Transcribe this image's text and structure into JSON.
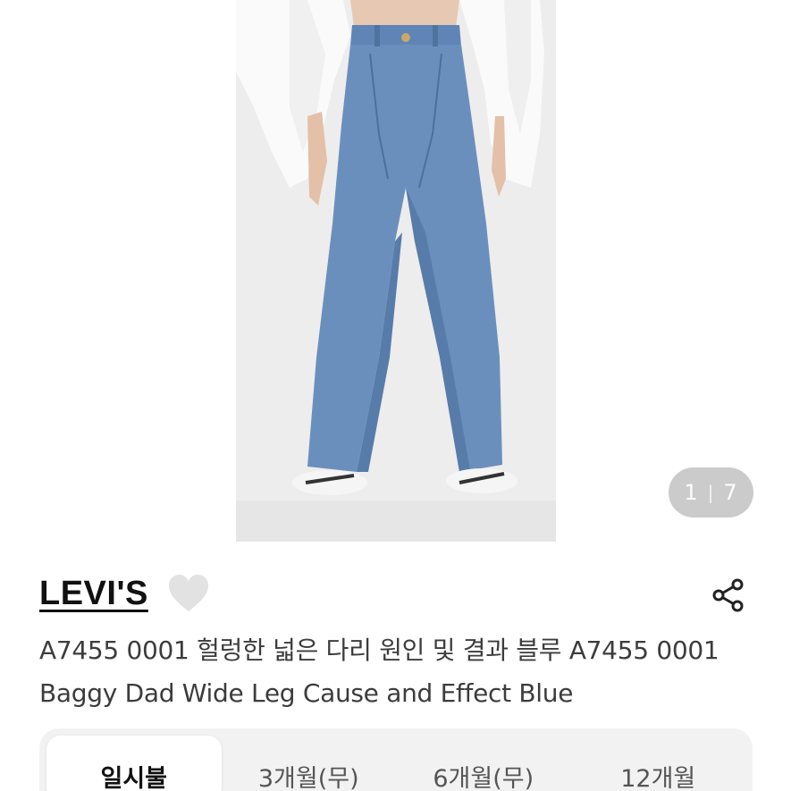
{
  "gallery": {
    "current_page": "1",
    "total_pages": "7",
    "separator": "|"
  },
  "product": {
    "brand": "LEVI'S",
    "title": "A7455 0001 헐렁한 넓은 다리 원인 및 결과 블루 A7455 0001 Baggy Dad Wide Leg Cause and Effect Blue",
    "icons": {
      "favorite": "heart-icon",
      "share": "share-icon"
    }
  },
  "payment_tabs": [
    {
      "label": "일시불",
      "active": true
    },
    {
      "label": "3개월(무)",
      "active": false
    },
    {
      "label": "6개월(무)",
      "active": false
    },
    {
      "label": "12개월",
      "active": false
    }
  ],
  "colors": {
    "denim": "#6b8fbd",
    "heart": "#e0e0e0",
    "counter_bg": "#a0a0a0"
  }
}
